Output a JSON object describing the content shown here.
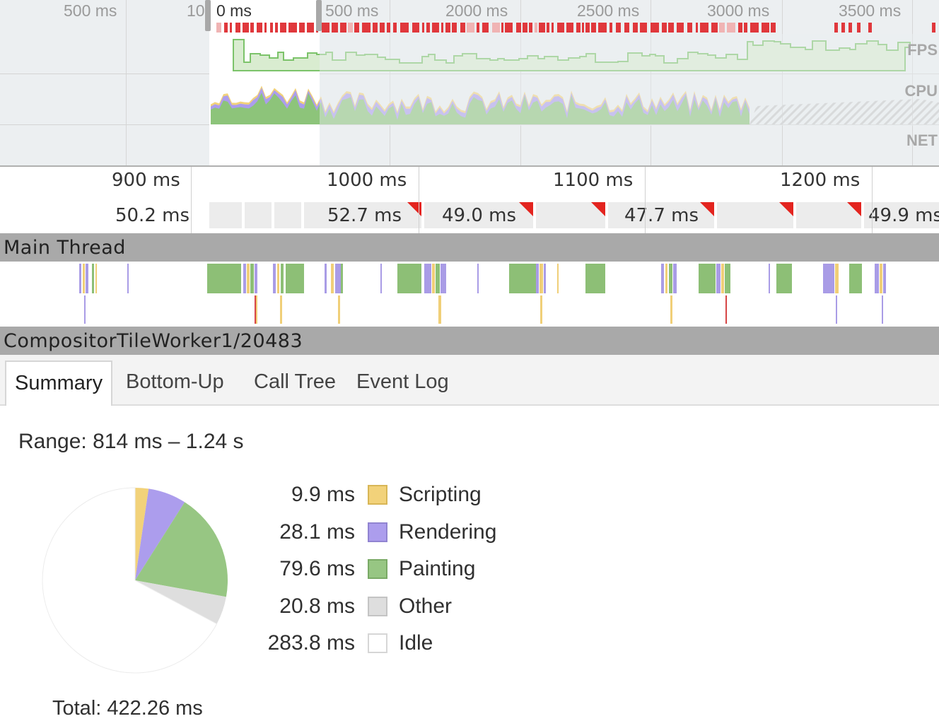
{
  "overview": {
    "time_labels": [
      "500 ms",
      "500 ms",
      "2000 ms",
      "2500 ms",
      "3000 ms",
      "3500 ms"
    ],
    "selection_start_label": "10",
    "selection_zero_label": "0 ms",
    "tracks": [
      "FPS",
      "CPU",
      "NET"
    ]
  },
  "ruler": {
    "ticks": [
      "900 ms",
      "1000 ms",
      "1100 ms",
      "1200 ms"
    ],
    "frames": [
      "50.2 ms",
      "52.7 ms",
      "49.0 ms",
      "47.7 ms",
      "49.9 ms"
    ]
  },
  "threads": {
    "main": "Main Thread",
    "compositor": "CompositorTileWorker1/20483"
  },
  "tabs": [
    "Summary",
    "Bottom-Up",
    "Call Tree",
    "Event Log"
  ],
  "active_tab": "Summary",
  "summary": {
    "range": "Range: 814 ms – 1.24 s",
    "total": "Total: 422.26 ms",
    "categories": [
      {
        "value": "9.9 ms",
        "label": "Scripting",
        "ms": 9.9,
        "fill": "#f2d27a",
        "border": "#d8b656"
      },
      {
        "value": "28.1 ms",
        "label": "Rendering",
        "ms": 28.1,
        "fill": "#ac9ded",
        "border": "#9184d1"
      },
      {
        "value": "79.6 ms",
        "label": "Painting",
        "ms": 79.6,
        "fill": "#97c683",
        "border": "#7aaa66"
      },
      {
        "value": "20.8 ms",
        "label": "Other",
        "ms": 20.8,
        "fill": "#dedede",
        "border": "#c4c4c4"
      },
      {
        "value": "283.8 ms",
        "label": "Idle",
        "ms": 283.8,
        "fill": "#ffffff",
        "border": "#d6d6d6"
      }
    ]
  }
}
